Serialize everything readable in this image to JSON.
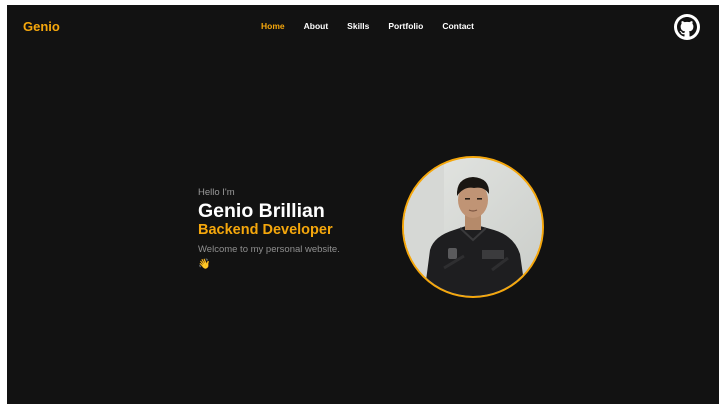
{
  "brand": "Genio",
  "nav": {
    "items": [
      {
        "label": "Home",
        "active": true
      },
      {
        "label": "About",
        "active": false
      },
      {
        "label": "Skills",
        "active": false
      },
      {
        "label": "Portfolio",
        "active": false
      },
      {
        "label": "Contact",
        "active": false
      }
    ]
  },
  "github": {
    "icon": "github-icon"
  },
  "hero": {
    "greeting": "Hello I'm",
    "name": "Genio Brillian",
    "role": "Backend Developer",
    "welcome": "Welcome to my personal website.",
    "wave": "👋"
  },
  "colors": {
    "accent": "#f5a70c",
    "background": "#121212",
    "text": "#ffffff",
    "muted": "#8f8f8f"
  }
}
